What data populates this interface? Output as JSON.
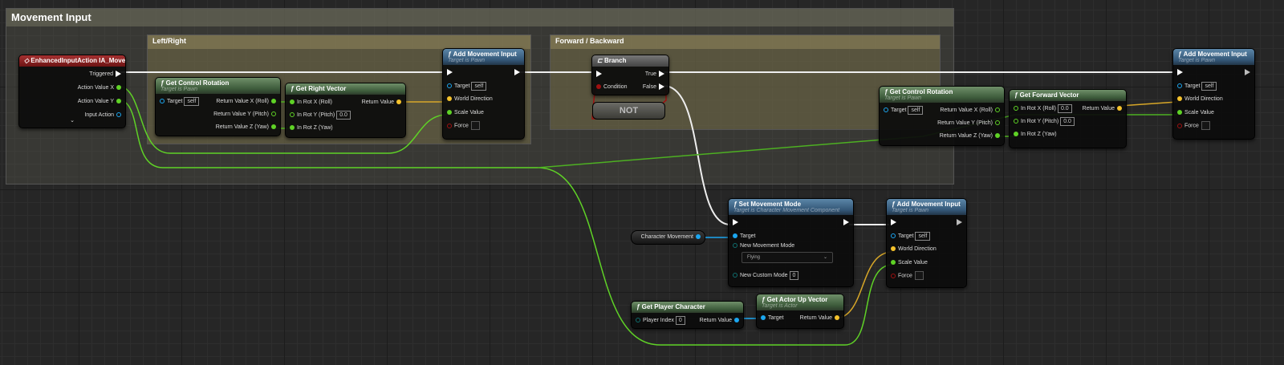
{
  "comments": [
    {
      "id": "movement-input",
      "title": "Movement Input"
    },
    {
      "id": "left-right",
      "title": "Left/Right"
    },
    {
      "id": "forward-backward",
      "title": "Forward / Backward"
    }
  ],
  "colors": {
    "exec": "#ffffff",
    "float": "#5fd226",
    "vector": "#f5c22c",
    "object": "#1ba6f0",
    "bool": "#a01010",
    "byte": "#0f6e6e",
    "event_header": "#8b1d1d",
    "pure_header": "#4a6e47",
    "call_header": "#3d6585"
  },
  "nodes": [
    {
      "id": "ev",
      "title": "EnhancedInputAction IA_Move",
      "icon": "event-diamond-icon",
      "hdr": "red",
      "rows": [
        {
          "r": {
            "label": "Triggered",
            "type": "exec"
          }
        },
        {
          "r": {
            "label": "Action Value X",
            "type": "float"
          }
        },
        {
          "r": {
            "label": "Action Value Y",
            "type": "float"
          }
        },
        {
          "r": {
            "label": "Input Action",
            "type": "object",
            "hollow": true
          }
        }
      ],
      "expand": "⌄"
    },
    {
      "id": "gcr1",
      "title": "Get Control Rotation",
      "subtitle": "Target is Pawn",
      "hdr": "green",
      "rows": [
        {
          "l": {
            "label": "Target",
            "type": "object",
            "hollow": true,
            "value": "self"
          },
          "r": {
            "label": "Return Value X (Roll)",
            "type": "float"
          }
        },
        {
          "r": {
            "label": "Return Value Y (Pitch)",
            "type": "float",
            "hollow": true
          }
        },
        {
          "r": {
            "label": "Return Value Z (Yaw)",
            "type": "float"
          }
        }
      ]
    },
    {
      "id": "grv",
      "title": "Get Right Vector",
      "hdr": "green",
      "rows": [
        {
          "l": {
            "label": "In Rot X (Roll)",
            "type": "float"
          },
          "r": {
            "label": "Return Value",
            "type": "vector"
          }
        },
        {
          "l": {
            "label": "In Rot Y (Pitch)",
            "type": "float",
            "hollow": true,
            "value": "0.0"
          }
        },
        {
          "l": {
            "label": "In Rot Z (Yaw)",
            "type": "float"
          }
        }
      ]
    },
    {
      "id": "ami1",
      "title": "Add Movement Input",
      "subtitle": "Target is Pawn",
      "hdr": "blue",
      "rows": [
        {
          "l": {
            "label": "",
            "type": "exec"
          },
          "r": {
            "label": "",
            "type": "exec"
          }
        },
        {
          "l": {
            "label": "Target",
            "type": "object",
            "hollow": true,
            "value": "self"
          }
        },
        {
          "l": {
            "label": "World Direction",
            "type": "vector"
          }
        },
        {
          "l": {
            "label": "Scale Value",
            "type": "float"
          }
        },
        {
          "l": {
            "label": "Force",
            "type": "bool",
            "hollow": true,
            "check": true
          }
        }
      ]
    },
    {
      "id": "br",
      "title": "Branch",
      "icon": "branch-icon",
      "hdr": "gray",
      "rows": [
        {
          "l": {
            "label": "",
            "type": "exec"
          },
          "r": {
            "label": "True",
            "type": "exec"
          }
        },
        {
          "l": {
            "label": "Condition",
            "type": "bool"
          },
          "r": {
            "label": "False",
            "type": "exec"
          }
        }
      ]
    },
    {
      "id": "gcr2",
      "title": "Get Control Rotation",
      "subtitle": "Target is Pawn",
      "hdr": "green",
      "rows": [
        {
          "l": {
            "label": "Target",
            "type": "object",
            "hollow": true,
            "value": "self"
          },
          "r": {
            "label": "Return Value X (Roll)",
            "type": "float",
            "hollow": true
          }
        },
        {
          "r": {
            "label": "Return Value Y (Pitch)",
            "type": "float",
            "hollow": true
          }
        },
        {
          "r": {
            "label": "Return Value Z (Yaw)",
            "type": "float"
          }
        }
      ]
    },
    {
      "id": "gfv",
      "title": "Get Forward Vector",
      "hdr": "green",
      "rows": [
        {
          "l": {
            "label": "In Rot X (Roll)",
            "type": "float",
            "hollow": true,
            "value": "0.0"
          },
          "r": {
            "label": "Return Value",
            "type": "vector"
          }
        },
        {
          "l": {
            "label": "In Rot Y (Pitch)",
            "type": "float",
            "hollow": true,
            "value": "0.0"
          }
        },
        {
          "l": {
            "label": "In Rot Z (Yaw)",
            "type": "float"
          }
        }
      ]
    },
    {
      "id": "ami3",
      "title": "Add Movement Input",
      "subtitle": "Target is Pawn",
      "hdr": "blue",
      "rows": [
        {
          "l": {
            "label": "",
            "type": "exec"
          },
          "r": {
            "label": "",
            "type": "exec",
            "hollow": true
          }
        },
        {
          "l": {
            "label": "Target",
            "type": "object",
            "hollow": true,
            "value": "self"
          }
        },
        {
          "l": {
            "label": "World Direction",
            "type": "vector"
          }
        },
        {
          "l": {
            "label": "Scale Value",
            "type": "float"
          }
        },
        {
          "l": {
            "label": "Force",
            "type": "bool",
            "hollow": true,
            "check": true
          }
        }
      ]
    },
    {
      "id": "smm",
      "title": "Set Movement Mode",
      "subtitle": "Target is Character Movement Component",
      "hdr": "blue",
      "rows": [
        {
          "l": {
            "label": "",
            "type": "exec"
          },
          "r": {
            "label": "",
            "type": "exec"
          }
        },
        {
          "l": {
            "label": "Target",
            "type": "object"
          }
        },
        {
          "l": {
            "label": "New Movement Mode",
            "type": "byte",
            "hollow": true,
            "dropdown": "Flying"
          }
        },
        {},
        {
          "l": {
            "label": "New Custom Mode",
            "type": "byte",
            "hollow": true,
            "value": "0"
          }
        }
      ]
    },
    {
      "id": "ami2",
      "title": "Add Movement Input",
      "subtitle": "Target is Pawn",
      "hdr": "blue",
      "rows": [
        {
          "l": {
            "label": "",
            "type": "exec"
          },
          "r": {
            "label": "",
            "type": "exec",
            "hollow": true
          }
        },
        {
          "l": {
            "label": "Target",
            "type": "object",
            "hollow": true,
            "value": "self"
          }
        },
        {
          "l": {
            "label": "World Direction",
            "type": "vector"
          }
        },
        {
          "l": {
            "label": "Scale Value",
            "type": "float"
          }
        },
        {
          "l": {
            "label": "Force",
            "type": "bool",
            "hollow": true,
            "check": true
          }
        }
      ]
    },
    {
      "id": "gpc",
      "title": "Get Player Character",
      "hdr": "green",
      "rows": [
        {
          "l": {
            "label": "Player Index",
            "type": "byte",
            "hollow": true,
            "value": "0"
          },
          "r": {
            "label": "Return Value",
            "type": "object"
          }
        }
      ]
    },
    {
      "id": "gauv",
      "title": "Get Actor Up Vector",
      "subtitle": "Target is Actor",
      "hdr": "green",
      "rows": [
        {
          "l": {
            "label": "Target",
            "type": "object"
          },
          "r": {
            "label": "Return Value",
            "type": "vector"
          }
        }
      ]
    }
  ],
  "not_node": {
    "label": "NOT"
  },
  "variable_node": {
    "label": "Character Movement",
    "type": "object"
  }
}
